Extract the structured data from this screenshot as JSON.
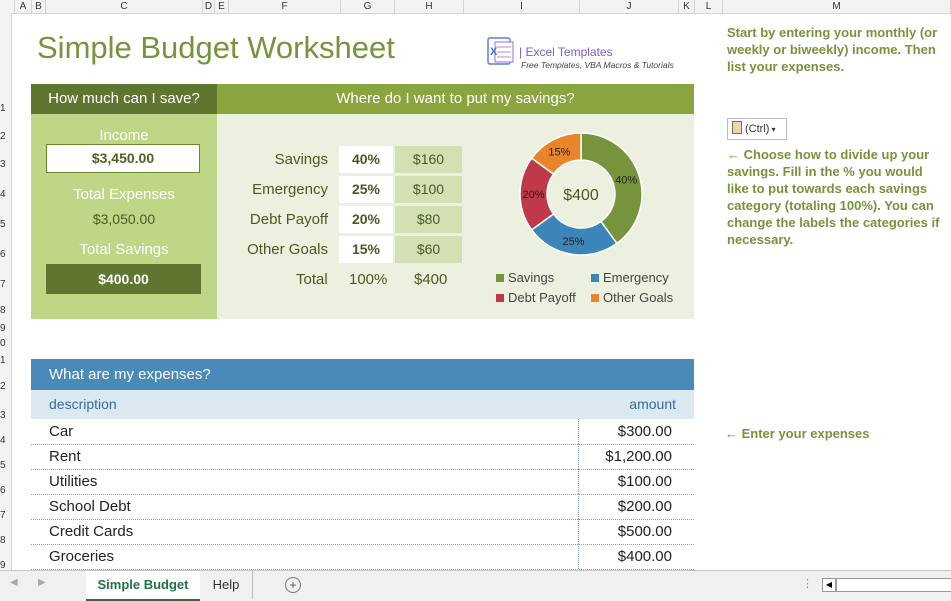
{
  "columns": [
    "A",
    "B",
    "C",
    "D",
    "E",
    "F",
    "G",
    "H",
    "I",
    "J",
    "K",
    "L",
    "M"
  ],
  "rows": [
    "1",
    "2",
    "3",
    "4",
    "5",
    "6",
    "7",
    "8",
    "9",
    "0",
    "1",
    "2",
    "3",
    "4",
    "5",
    "6",
    "7",
    "8",
    "9"
  ],
  "title": "Simple Budget Worksheet",
  "logo": {
    "title": "| Excel Templates",
    "subtitle": "Free Templates, VBA Macros & Tutorials"
  },
  "left": {
    "header": "How much can I save?",
    "income_label": "Income",
    "income_value": "$3,450.00",
    "total_expenses_label": "Total Expenses",
    "total_expenses_value": "$3,050.00",
    "total_savings_label": "Total Savings",
    "total_savings_value": "$400.00"
  },
  "savings": {
    "header": "Where do I want to put my savings?",
    "items": [
      {
        "label": "Savings",
        "pct": "40%",
        "amount": "$160"
      },
      {
        "label": "Emergency",
        "pct": "25%",
        "amount": "$100"
      },
      {
        "label": "Debt Payoff",
        "pct": "20%",
        "amount": "$80"
      },
      {
        "label": "Other Goals",
        "pct": "15%",
        "amount": "$60"
      }
    ],
    "total_label": "Total",
    "total_pct": "100%",
    "total_amount": "$400"
  },
  "chart_data": {
    "type": "pie",
    "categories": [
      "Savings",
      "Emergency",
      "Debt Payoff",
      "Other Goals"
    ],
    "values": [
      40,
      25,
      20,
      15
    ],
    "labels": [
      "40%",
      "25%",
      "20%",
      "15%"
    ],
    "center_label": "$400",
    "colors": [
      "#77933c",
      "#3c85b8",
      "#c0394a",
      "#e8842a"
    ],
    "legend": "bottom"
  },
  "expenses": {
    "header": "What are my expenses?",
    "col_description": "description",
    "col_amount": "amount",
    "rows": [
      {
        "description": "Car",
        "amount": "$300.00"
      },
      {
        "description": "Rent",
        "amount": "$1,200.00"
      },
      {
        "description": "Utilities",
        "amount": "$100.00"
      },
      {
        "description": "School Debt",
        "amount": "$200.00"
      },
      {
        "description": "Credit Cards",
        "amount": "$500.00"
      },
      {
        "description": "Groceries",
        "amount": "$400.00"
      }
    ]
  },
  "notes": {
    "intro": "Start by entering your monthly (or weekly or biweekly) income. Then list your expenses.",
    "paste": "(Ctrl)",
    "savings": "← Choose how to divide up your savings. Fill in the % you would like to put towards each savings category (totaling 100%). You can change the labels the categories if necessary.",
    "expenses": "← Enter your expenses"
  },
  "tabs": {
    "active": "Simple Budget",
    "other": "Help"
  },
  "colors": {
    "green_dark": "#5f7530",
    "green": "#8aa53e",
    "blue": "#4a8ab8"
  }
}
